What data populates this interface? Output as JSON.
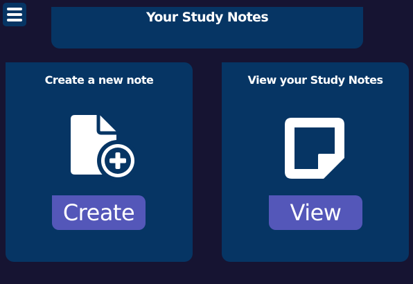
{
  "header": {
    "title": "Your Study Notes"
  },
  "menu": {
    "icon": "hamburger-menu-icon"
  },
  "cards": {
    "create": {
      "title": "Create a new note",
      "icon": "file-add-icon",
      "button_label": "Create"
    },
    "view": {
      "title": "View your Study Notes",
      "icon": "sticky-note-icon",
      "button_label": "View"
    }
  },
  "colors": {
    "background": "#161432",
    "panel": "#063564",
    "accent_button": "#5457b9",
    "text": "#ffffff"
  }
}
